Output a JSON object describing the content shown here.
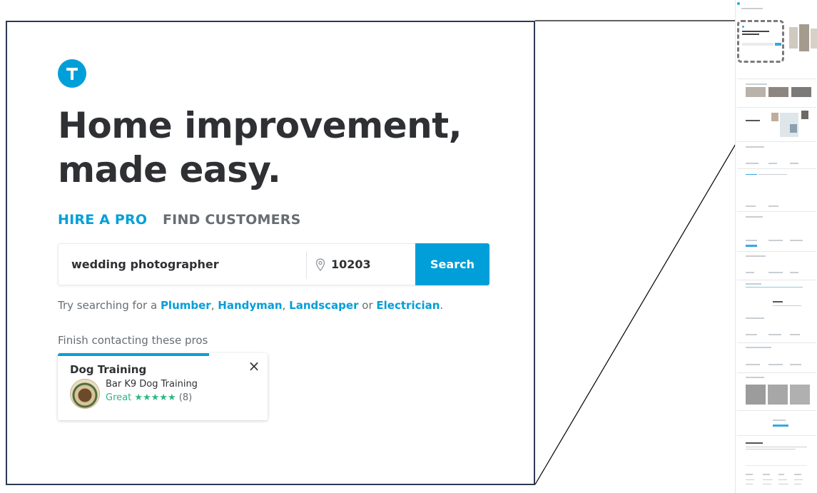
{
  "hero": {
    "headline": "Home improvement, made easy.",
    "tabs": [
      {
        "label": "HIRE A PRO",
        "active": true
      },
      {
        "label": "FIND CUSTOMERS",
        "active": false
      }
    ]
  },
  "search": {
    "query": "wedding photographer",
    "zip": "10203",
    "button_label": "Search"
  },
  "suggestions": {
    "prefix": "Try searching for a",
    "items": [
      "Plumber",
      "Handyman",
      "Landscaper",
      "Electrician"
    ],
    "sep1": ",",
    "sep2": ",",
    "or_word": "or",
    "end": "."
  },
  "finish": {
    "label": "Finish contacting these pros",
    "card": {
      "title": "Dog Training",
      "close_icon": "×",
      "pro_name": "Bar K9 Dog Training",
      "rating_word": "Great",
      "stars": "★★★★★",
      "review_count": "(8)",
      "progress_fraction": 0.72
    }
  },
  "icons": [
    "logo-icon",
    "location-pin-icon",
    "close-icon",
    "star-icon"
  ],
  "colors": {
    "brand_blue": "#009fd9",
    "heading": "#2f3033",
    "muted": "#676d73",
    "rating_green": "#2db783",
    "frame": "#2b3a55"
  }
}
